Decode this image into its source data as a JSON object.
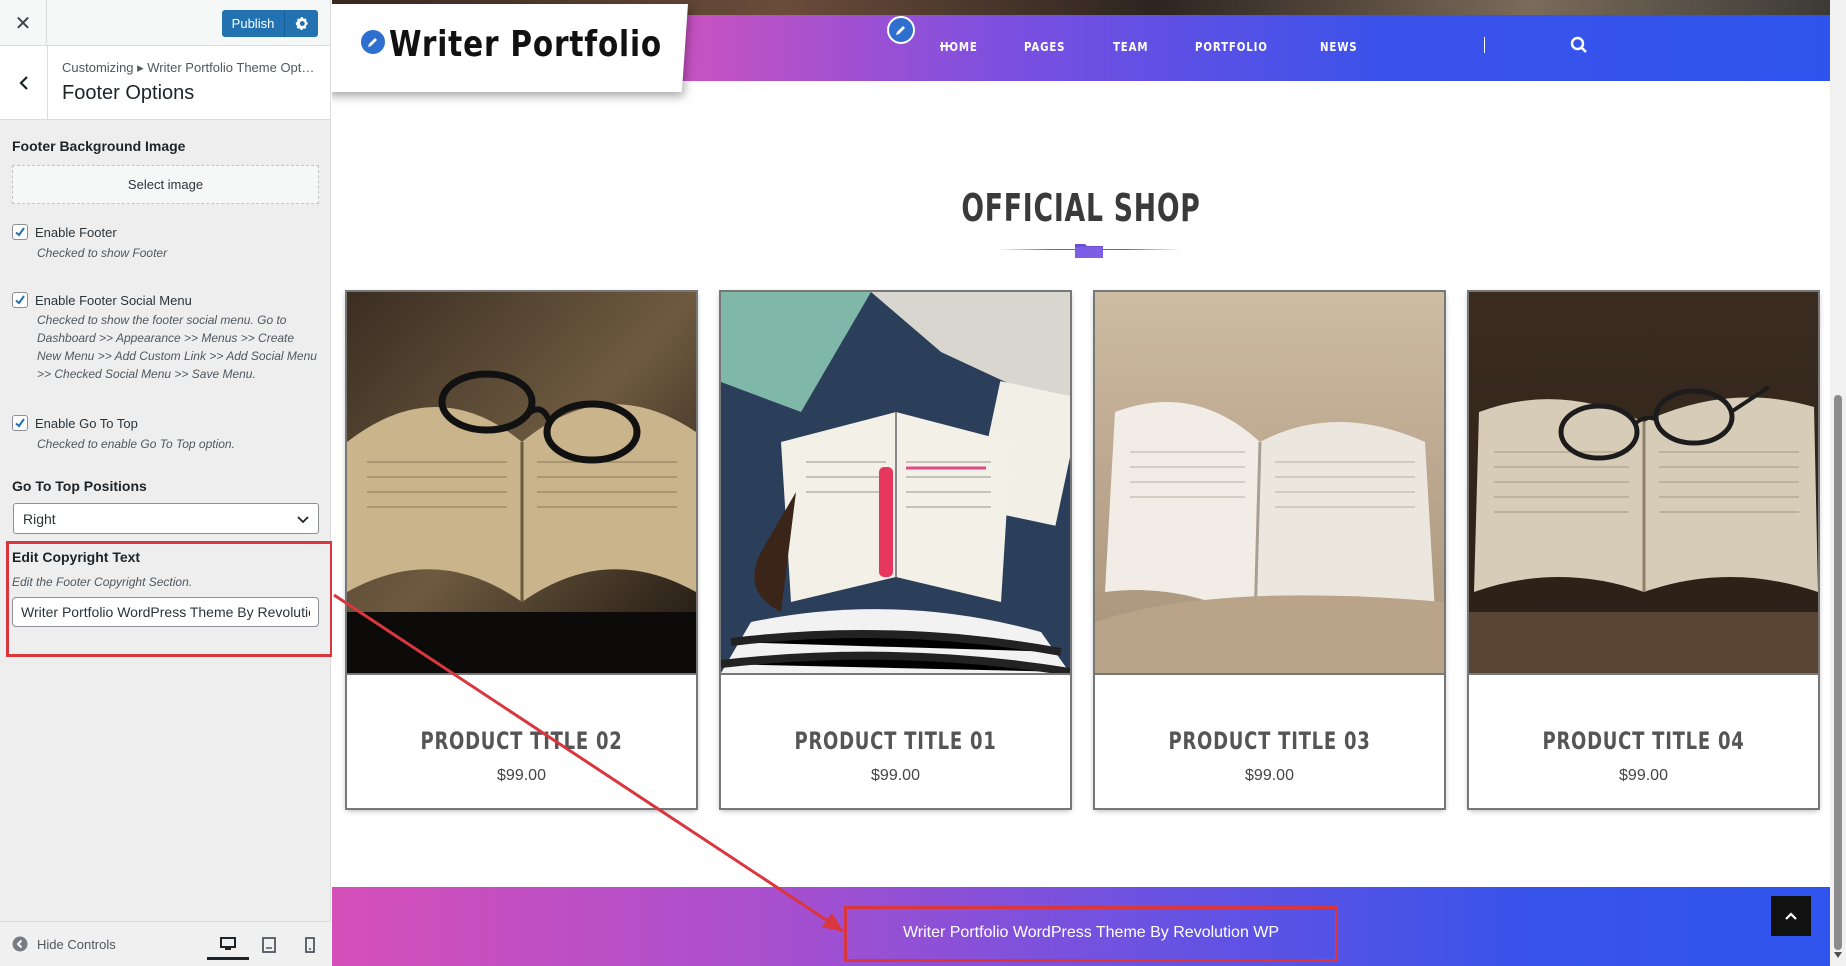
{
  "customizer": {
    "publish_label": "Publish",
    "breadcrumb": "Customizing ▸ Writer Portfolio Theme Opt…",
    "section_title": "Footer Options",
    "footer_bg": {
      "title": "Footer Background Image",
      "button": "Select image"
    },
    "enable_footer": {
      "label": "Enable Footer",
      "desc": "Checked to show Footer",
      "checked": true
    },
    "enable_social": {
      "label": "Enable Footer Social Menu",
      "desc": "Checked to show the footer social menu. Go to Dashboard >> Appearance >> Menus >> Create New Menu >> Add Custom Link >> Add Social Menu >> Checked Social Menu >> Save Menu.",
      "checked": true
    },
    "enable_gotop": {
      "label": "Enable Go To Top",
      "desc": "Checked to enable Go To Top option.",
      "checked": true
    },
    "gotop_positions": {
      "title": "Go To Top Positions",
      "value": "Right"
    },
    "copyright": {
      "title": "Edit Copyright Text",
      "desc": "Edit the Footer Copyright Section.",
      "value": "Writer Portfolio WordPress Theme By Revolution WP"
    },
    "hide_controls": "Hide Controls"
  },
  "site": {
    "logo_text": "Writer Portfolio",
    "nav": [
      "HOME",
      "PAGES",
      "TEAM",
      "PORTFOLIO",
      "NEWS"
    ],
    "shop_title": "OFFICIAL SHOP",
    "products": [
      {
        "title": "PRODUCT TITLE 02",
        "price": "$99.00"
      },
      {
        "title": "PRODUCT TITLE 01",
        "price": "$99.00"
      },
      {
        "title": "PRODUCT TITLE 03",
        "price": "$99.00"
      },
      {
        "title": "PRODUCT TITLE 04",
        "price": "$99.00"
      }
    ],
    "footer_text": "Writer Portfolio WordPress Theme By Revolution WP"
  },
  "colors": {
    "accent_blue": "#2271b1",
    "nav_gradient_start": "#e04fb1",
    "nav_gradient_end": "#2f54ee",
    "highlight_red": "#d9363e"
  }
}
